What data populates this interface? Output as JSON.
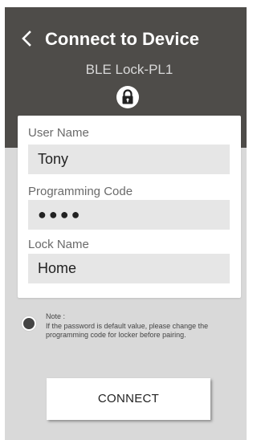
{
  "header": {
    "title": "Connect to Device",
    "device_name": "BLE Lock-PL1",
    "back_icon": "chevron-left-icon",
    "lock_icon": "padlock-icon"
  },
  "form": {
    "user_name": {
      "label": "User Name",
      "value": "Tony"
    },
    "programming_code": {
      "label": "Programming Code",
      "value": "●●●●"
    },
    "lock_name": {
      "label": "Lock Name",
      "value": "Home"
    }
  },
  "note": {
    "title": "Note :",
    "body": "If the password is default value, please change the programming code for locker before pairing."
  },
  "actions": {
    "connect_label": "CONNECT"
  },
  "colors": {
    "header_bg": "#4e4c49",
    "screen_bg": "#d9d9d9",
    "field_bg": "#e6e6e6"
  }
}
